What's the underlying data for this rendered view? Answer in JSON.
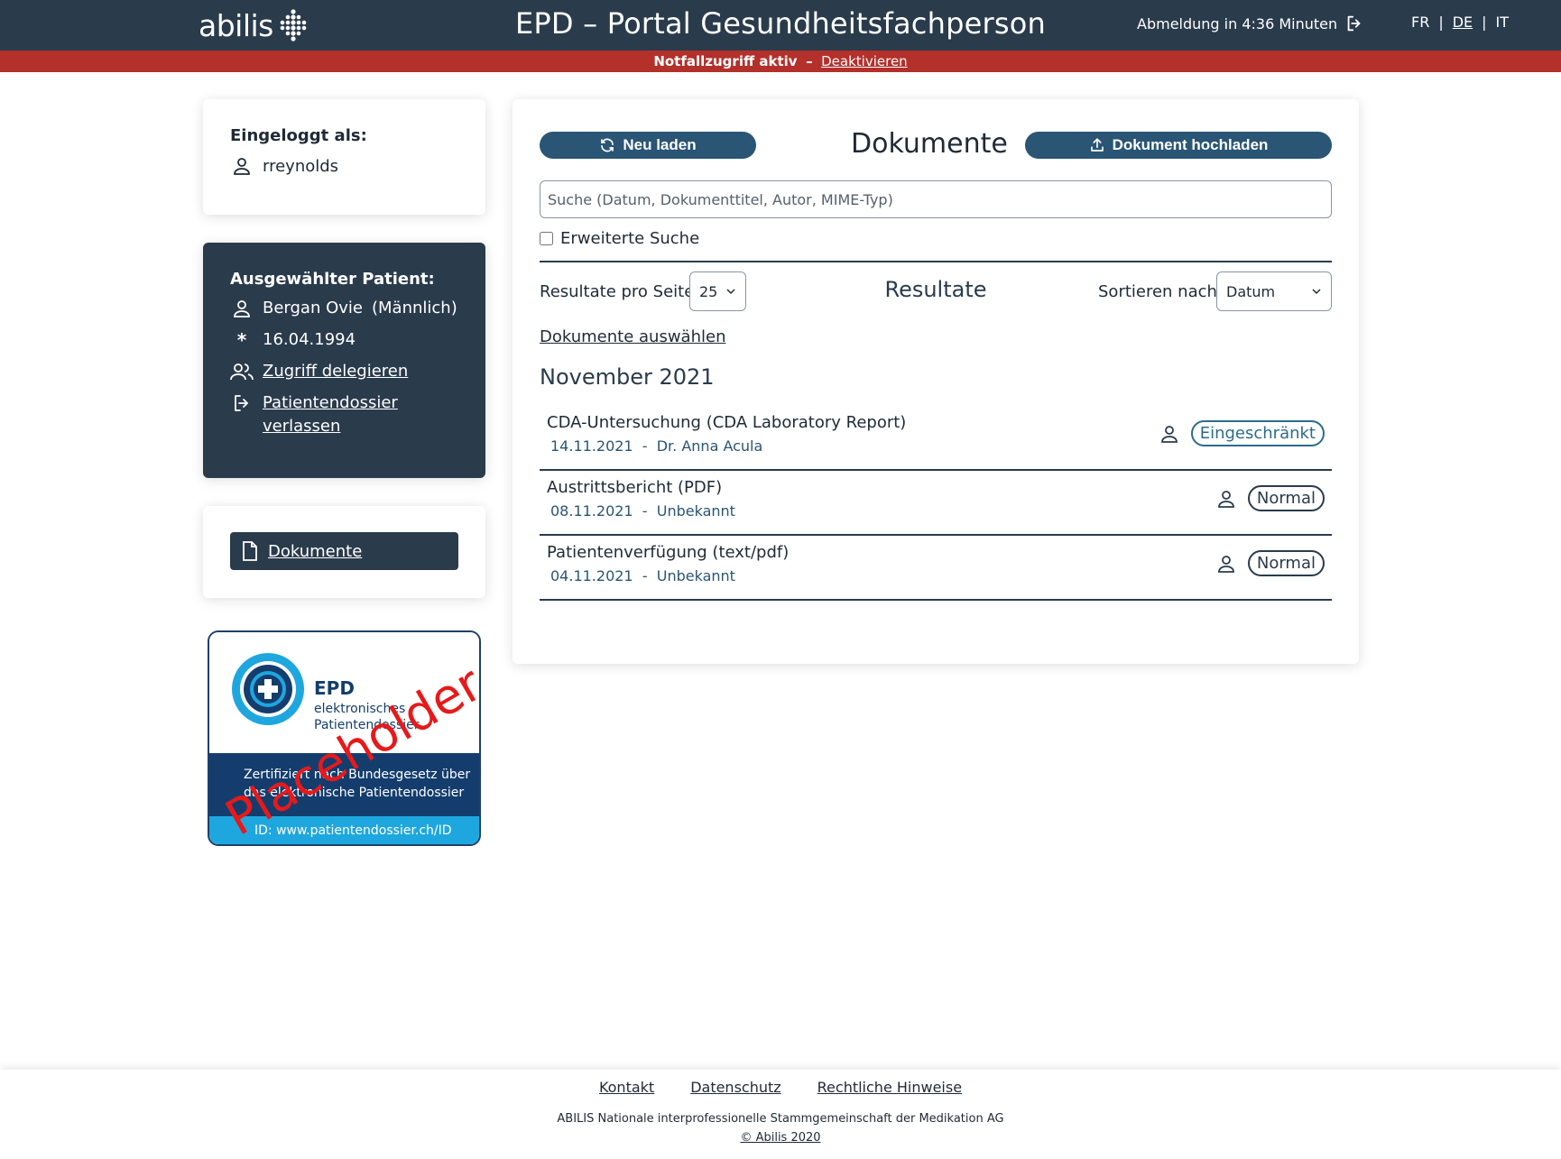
{
  "header": {
    "logo_text": "abilis",
    "title": "EPD – Portal Gesundheitsfachperson",
    "logout_text": "Abmeldung in 4:36 Minuten",
    "languages": [
      "FR",
      "DE",
      "IT"
    ],
    "active_language": "DE",
    "separator": "|"
  },
  "alert": {
    "text": "Notfallzugriff aktiv",
    "dash": "–",
    "link": "Deaktivieren",
    "color": "#b3302b"
  },
  "login": {
    "label": "Eingeloggt als:",
    "username": "rreynolds"
  },
  "patient": {
    "label": "Ausgewählter Patient:",
    "name": "Bergan Ovie",
    "gender": "(Männlich)",
    "birth_symbol": "*",
    "birthdate": "16.04.1994",
    "delegate_link": "Zugriff delegieren",
    "leave_link_line1": "Patientendossier",
    "leave_link_line2": "verlassen"
  },
  "nav": {
    "documents_label": "Dokumente"
  },
  "certificate": {
    "epd": "EPD",
    "sub_line1": "elektronisches",
    "sub_line2": "Patientendossier",
    "mid_line1": "Zertifiziert nach Bundesgesetz über",
    "mid_line2": "das elektronische Patientendossier",
    "id_line": "ID: www.patientendossier.ch/ID",
    "overlay": "Placeholder"
  },
  "main": {
    "reload_label": "Neu laden",
    "title": "Dokumente",
    "upload_label": "Dokument hochladen",
    "search_placeholder": "Suche (Datum, Dokumenttitel, Autor, MIME-Typ)",
    "advanced_search_label": "Erweiterte Suche",
    "per_page_label": "Resultate pro Seite",
    "per_page_value": "25",
    "results_title": "Resultate",
    "sort_label": "Sortieren nach",
    "sort_value": "Datum",
    "select_documents_link": "Dokumente auswählen",
    "month_heading": "November 2021",
    "documents": [
      {
        "title": "CDA-Untersuchung (CDA Laboratory Report)",
        "date": "14.11.2021",
        "sep": "-",
        "author": "Dr. Anna Acula",
        "badge": "Eingeschränkt"
      },
      {
        "title": "Austrittsbericht (PDF)",
        "date": "08.11.2021",
        "sep": "-",
        "author": "Unbekannt",
        "badge": "Normal"
      },
      {
        "title": "Patientenverfügung (text/pdf)",
        "date": "04.11.2021",
        "sep": "-",
        "author": "Unbekannt",
        "badge": "Normal"
      }
    ]
  },
  "footer": {
    "links": [
      "Kontakt",
      "Datenschutz",
      "Rechtliche Hinweise"
    ],
    "org": "ABILIS Nationale interprofessionelle Stammgemeinschaft der Medikation AG",
    "copyright": "© Abilis 2020"
  },
  "colors": {
    "header_bg": "#2a3b4c",
    "button_bg": "#2a5574",
    "restricted_badge": "#2a6c8e"
  }
}
